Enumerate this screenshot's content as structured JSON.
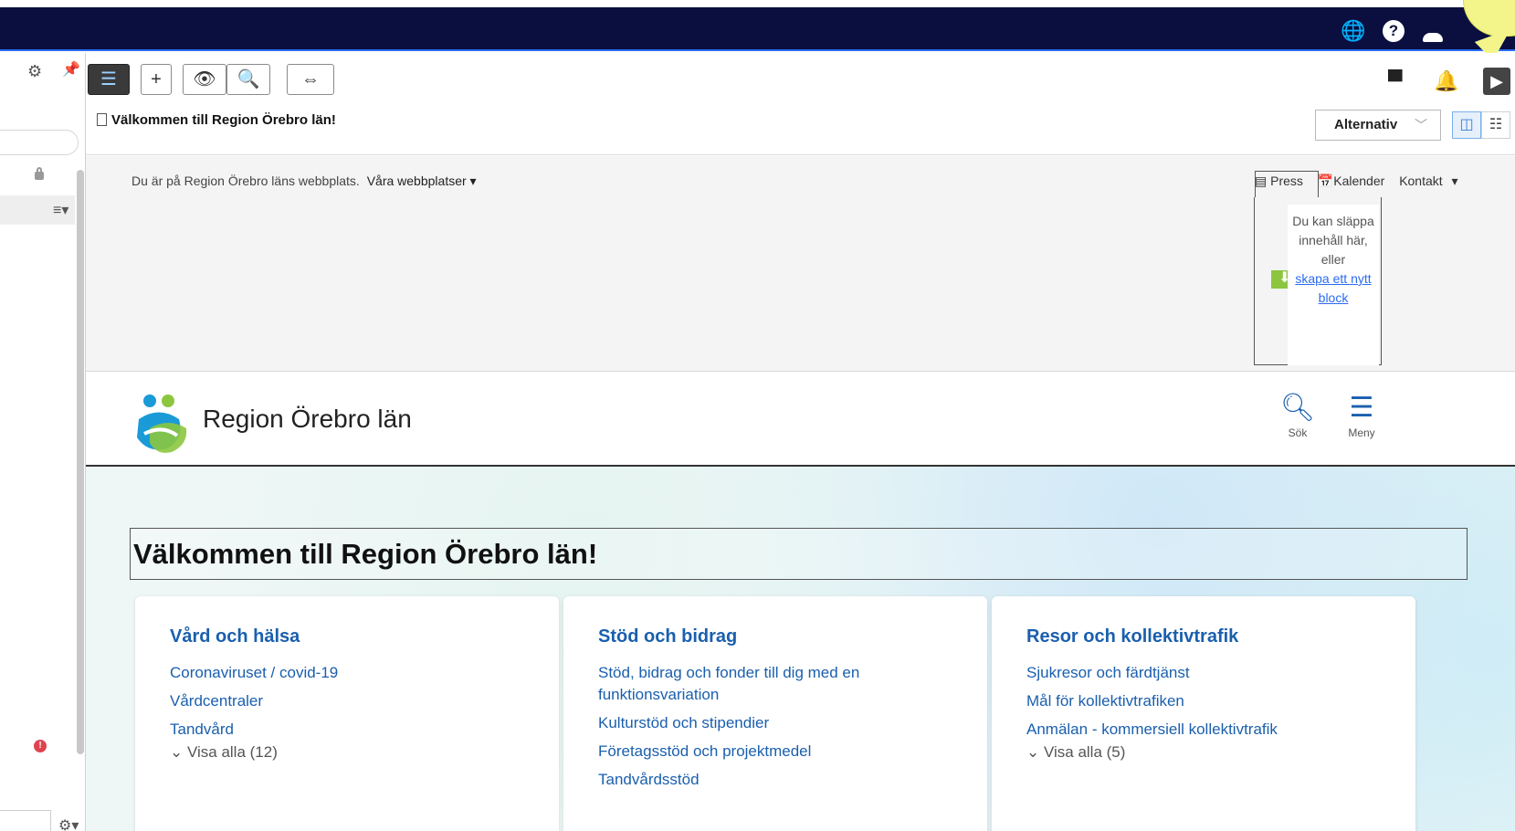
{
  "toolbar": {
    "page_title": "Välkommen till Region Örebro län!",
    "alternatives_label": "Alternativ"
  },
  "editband": {
    "site_text": "Du är på Region Örebro läns webbplats.",
    "websites_link": "Våra webbplatser",
    "press": "Press",
    "calendar": "Kalender",
    "contact": "Kontakt",
    "drop_text": "Du kan släppa innehåll här, eller",
    "drop_link": "skapa ett nytt block"
  },
  "site": {
    "brand": "Region Örebro län",
    "search_label": "Sök",
    "menu_label": "Meny",
    "welcome": "Välkommen till Region Örebro län!"
  },
  "cards": [
    {
      "title": "Vård och hälsa",
      "items": [
        "Coronaviruset / covid-19",
        "Vårdcentraler",
        "Tandvård"
      ],
      "more": "Visa alla (12)"
    },
    {
      "title": "Stöd och bidrag",
      "items": [
        "Stöd, bidrag och fonder till dig med en funktionsvariation",
        "Kulturstöd och stipendier",
        "Företagsstöd och projektmedel",
        "Tandvårdsstöd"
      ],
      "more": ""
    },
    {
      "title": "Resor och kollektivtrafik",
      "items": [
        "Sjukresor och färdtjänst",
        "Mål för kollektivtrafiken",
        "Anmälan - kommersiell kollektivtrafik"
      ],
      "more": "Visa alla (5)"
    }
  ],
  "icons": {
    "globe": "globe-icon",
    "help": "help-icon",
    "user": "user-icon"
  },
  "colors": {
    "topbar": "#0a0f3f",
    "link": "#1a5fae",
    "drop_accent": "#8cc63f"
  }
}
